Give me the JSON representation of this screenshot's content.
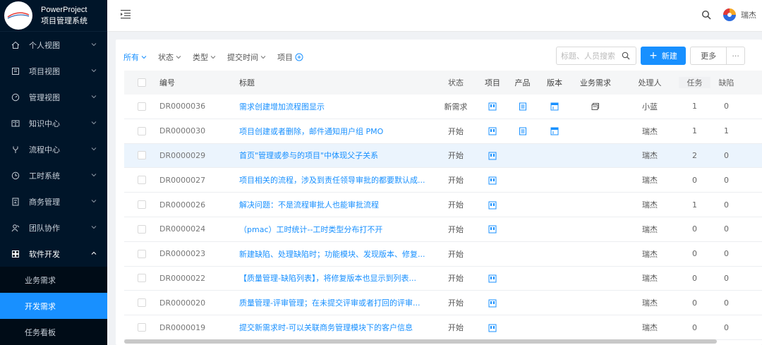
{
  "brand": {
    "name_en": "PowerProject",
    "name_cn": "项目管理系统"
  },
  "sidebar": {
    "items": [
      {
        "label": "个人视图",
        "icon": "home-icon"
      },
      {
        "label": "项目视图",
        "icon": "project-icon"
      },
      {
        "label": "管理视图",
        "icon": "dashboard-icon"
      },
      {
        "label": "知识中心",
        "icon": "book-icon"
      },
      {
        "label": "流程中心",
        "icon": "flow-icon"
      },
      {
        "label": "工时系统",
        "icon": "clock-icon"
      },
      {
        "label": "商务管理",
        "icon": "document-icon"
      },
      {
        "label": "团队协作",
        "icon": "team-icon"
      },
      {
        "label": "软件开发",
        "icon": "grid-icon"
      }
    ],
    "subitems": [
      {
        "label": "业务需求",
        "active": false
      },
      {
        "label": "开发需求",
        "active": true
      },
      {
        "label": "任务看板",
        "active": false
      }
    ]
  },
  "header": {
    "user_name": "瑞杰"
  },
  "filters": {
    "all": "所有",
    "status": "状态",
    "type": "类型",
    "submit_time": "提交时间",
    "project": "项目"
  },
  "search": {
    "placeholder": "标题、人员搜索"
  },
  "toolbar": {
    "new_label": "新建",
    "more_label": "更多",
    "dots_label": "···"
  },
  "table": {
    "headers": {
      "id": "编号",
      "title": "标题",
      "status": "状态",
      "project": "项目",
      "product": "产品",
      "version": "版本",
      "requirement": "业务需求",
      "owner": "处理人",
      "task": "任务",
      "bug": "缺陷"
    },
    "rows": [
      {
        "id": "DR0000036",
        "title": "需求创建增加流程图显示",
        "status": "新需求",
        "project": true,
        "product": true,
        "version": true,
        "requirement": true,
        "owner": "小蓝",
        "task": "1",
        "bug": "0"
      },
      {
        "id": "DR0000030",
        "title": "项目创建或者删除，邮件通知用户组 PMO",
        "status": "开始",
        "project": true,
        "product": true,
        "version": true,
        "requirement": false,
        "owner": "瑞杰",
        "task": "1",
        "bug": "1"
      },
      {
        "id": "DR0000029",
        "title": "首页\"管理或参与的项目\"中体现父子关系",
        "status": "开始",
        "project": true,
        "product": false,
        "version": false,
        "requirement": false,
        "owner": "瑞杰",
        "task": "2",
        "bug": "0"
      },
      {
        "id": "DR0000027",
        "title": "项目相关的流程，涉及到责任领导审批的都要默认成...",
        "status": "开始",
        "project": true,
        "product": false,
        "version": false,
        "requirement": false,
        "owner": "瑞杰",
        "task": "0",
        "bug": "0"
      },
      {
        "id": "DR0000026",
        "title": "解决问题：不是流程审批人也能审批流程",
        "status": "开始",
        "project": true,
        "product": false,
        "version": false,
        "requirement": false,
        "owner": "瑞杰",
        "task": "1",
        "bug": "0"
      },
      {
        "id": "DR0000024",
        "title": "（pmac）工时统计--工时类型分布打不开",
        "status": "开始",
        "project": true,
        "product": false,
        "version": false,
        "requirement": false,
        "owner": "瑞杰",
        "task": "0",
        "bug": "0"
      },
      {
        "id": "DR0000023",
        "title": "新建缺陷、处理缺陷时；功能模块、发现版本、修复...",
        "status": "开始",
        "project": false,
        "product": false,
        "version": false,
        "requirement": false,
        "owner": "瑞杰",
        "task": "0",
        "bug": "0"
      },
      {
        "id": "DR0000022",
        "title": "【质量管理-缺陷列表】，将修复版本也显示到列表...",
        "status": "开始",
        "project": true,
        "product": false,
        "version": false,
        "requirement": false,
        "owner": "瑞杰",
        "task": "0",
        "bug": "0"
      },
      {
        "id": "DR0000020",
        "title": "质量管理-评审管理；在未提交评审或者打回的评审...",
        "status": "开始",
        "project": true,
        "product": false,
        "version": false,
        "requirement": false,
        "owner": "瑞杰",
        "task": "0",
        "bug": "0"
      },
      {
        "id": "DR0000019",
        "title": "提交新需求时-可以关联商务管理模块下的客户信息",
        "status": "开始",
        "project": true,
        "product": false,
        "version": false,
        "requirement": false,
        "owner": "瑞杰",
        "task": "0",
        "bug": "0"
      }
    ]
  },
  "colors": {
    "sidebar_bg": "#001529",
    "accent": "#1890ff",
    "row_hover": "#ebf4fd"
  }
}
